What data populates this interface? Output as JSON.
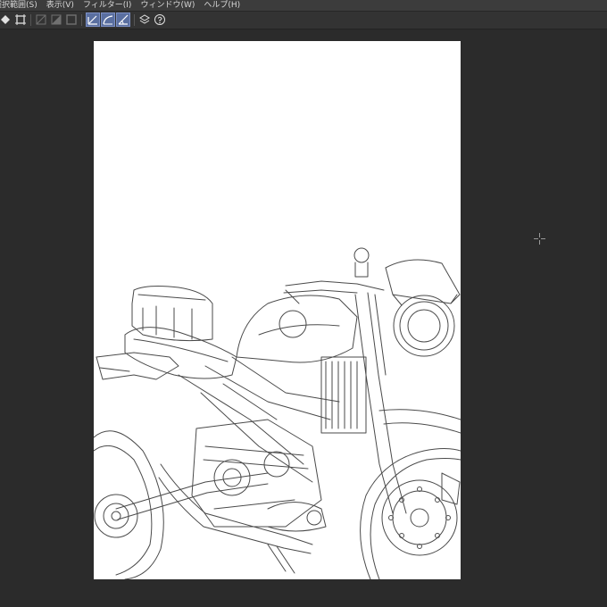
{
  "menu": {
    "items": [
      "選択範囲(S)",
      "表示(V)",
      "フィルター(I)",
      "ウィンドウ(W)",
      "ヘルプ(H)"
    ]
  },
  "toolbar": {
    "icons": [
      "fill-icon",
      "transform-icon",
      "clear-outside-icon",
      "fill-selection-icon",
      "square-icon",
      "line-correct-icon",
      "curve-correct-icon",
      "angle-correct-icon",
      "layer-icon",
      "help-icon"
    ]
  },
  "canvas": {
    "background": "#ffffff",
    "line_color": "#4a4a4a",
    "subject": "motorcycle-lineart"
  },
  "colors": {
    "workspace": "#2b2b2b",
    "menubar": "#3c3c3c",
    "toolbar": "#333333",
    "active_tool": "#5a6fa0"
  }
}
